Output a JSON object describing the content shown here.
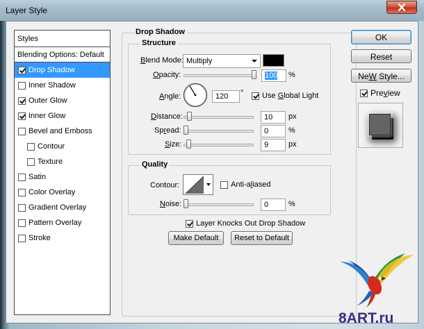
{
  "window": {
    "title": "Layer Style"
  },
  "styles_panel": {
    "header": "Styles",
    "blending_options": "Blending Options: Default",
    "items": [
      {
        "label": "Drop Shadow",
        "checked": true,
        "selected": true,
        "indent": false
      },
      {
        "label": "Inner Shadow",
        "checked": false,
        "selected": false,
        "indent": false
      },
      {
        "label": "Outer Glow",
        "checked": true,
        "selected": false,
        "indent": false
      },
      {
        "label": "Inner Glow",
        "checked": true,
        "selected": false,
        "indent": false
      },
      {
        "label": "Bevel and Emboss",
        "checked": false,
        "selected": false,
        "indent": false
      },
      {
        "label": "Contour",
        "checked": false,
        "selected": false,
        "indent": true
      },
      {
        "label": "Texture",
        "checked": false,
        "selected": false,
        "indent": true
      },
      {
        "label": "Satin",
        "checked": false,
        "selected": false,
        "indent": false
      },
      {
        "label": "Color Overlay",
        "checked": false,
        "selected": false,
        "indent": false
      },
      {
        "label": "Gradient Overlay",
        "checked": false,
        "selected": false,
        "indent": false
      },
      {
        "label": "Pattern Overlay",
        "checked": false,
        "selected": false,
        "indent": false
      },
      {
        "label": "Stroke",
        "checked": false,
        "selected": false,
        "indent": false
      }
    ]
  },
  "drop_shadow": {
    "title": "Drop Shadow",
    "structure": {
      "title": "Structure",
      "blend_mode": {
        "label_u": "B",
        "label_rest": "lend Mode:",
        "value": "Multiply",
        "color": "#000000"
      },
      "opacity": {
        "label_u": "O",
        "label_rest": "pacity:",
        "value": "100",
        "unit": "%",
        "level": 1.0
      },
      "angle": {
        "label_u": "A",
        "label_rest": "ngle:",
        "value": "120",
        "unit": "°"
      },
      "use_global_light": {
        "label_pre": "Use ",
        "label_u": "G",
        "label_rest": "lobal Light",
        "checked": true
      },
      "distance": {
        "label_u": "D",
        "label_rest": "istance:",
        "value": "10",
        "unit": "px",
        "level": 0.05
      },
      "spread": {
        "label_pre": "Sp",
        "label_u": "r",
        "label_rest": "ead:",
        "value": "0",
        "unit": "%",
        "level": 0.0
      },
      "size": {
        "label_u": "S",
        "label_rest": "ize:",
        "value": "9",
        "unit": "px",
        "level": 0.04
      }
    },
    "quality": {
      "title": "Quality",
      "contour_label": "Contour:",
      "anti_aliased": {
        "label_pre": "Anti-a",
        "label_u": "l",
        "label_rest": "iased",
        "checked": false
      },
      "noise": {
        "label_u": "N",
        "label_rest": "oise:",
        "value": "0",
        "unit": "%",
        "level": 0.0
      }
    },
    "layer_knocks_out": {
      "label": "Layer Knocks Out Drop Shadow",
      "checked": true
    },
    "make_default": "Make Default",
    "reset_to_default": "Reset to Default"
  },
  "buttons": {
    "ok": "OK",
    "reset": "Reset",
    "new_style_u": "W",
    "new_style_pre": "Ne",
    "new_style_rest": " Style...",
    "preview": {
      "label_pre": "Pre",
      "label_u": "v",
      "label_rest": "iew",
      "checked": true
    }
  },
  "colors": {
    "selection": "#3399ff",
    "window_bg": "#f0f0f0"
  },
  "watermark": "8ART.ru"
}
